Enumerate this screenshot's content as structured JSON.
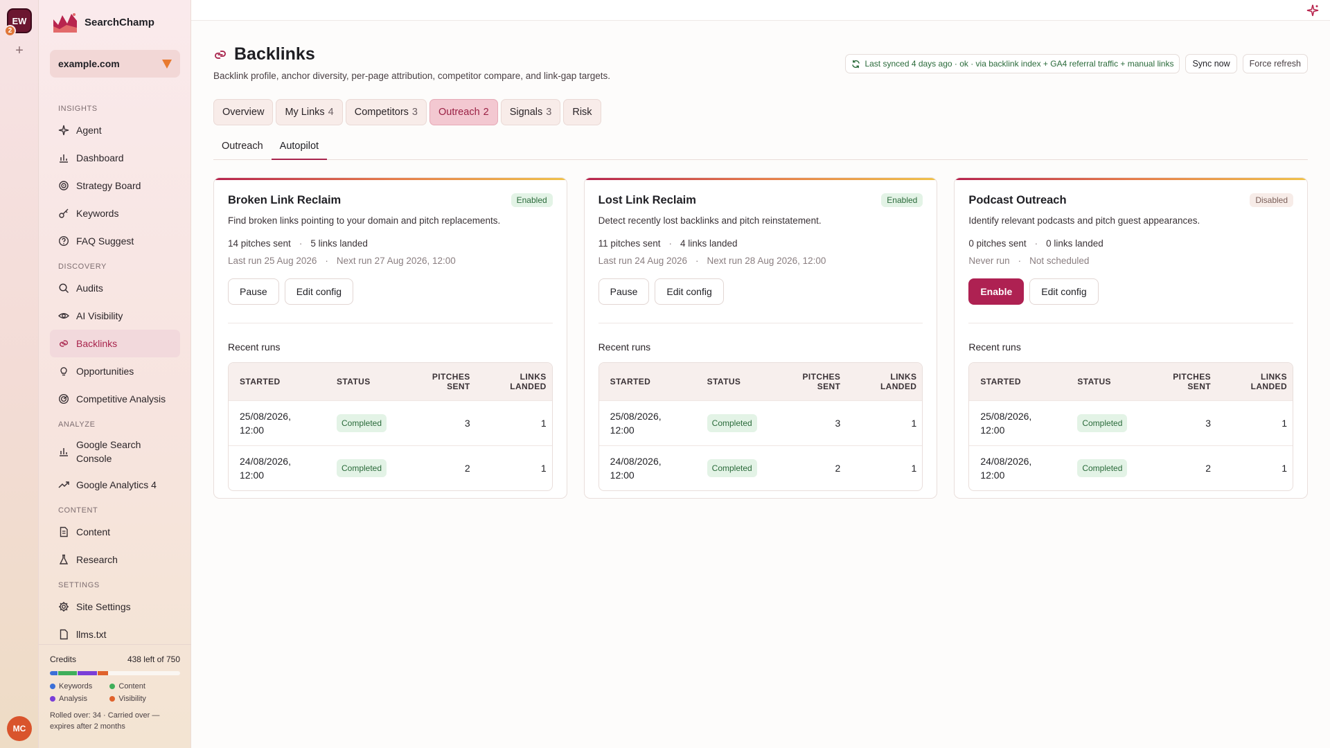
{
  "rail": {
    "workspace_initials": "EW",
    "workspace_badge": "2",
    "add_label": "+",
    "user_initials": "MC"
  },
  "brand": {
    "name": "SearchChamp"
  },
  "domain": {
    "value": "example.com"
  },
  "nav": {
    "sections": [
      {
        "label": "Insights",
        "items": [
          {
            "label": "Agent",
            "icon": "sparkle-icon"
          },
          {
            "label": "Dashboard",
            "icon": "bar-chart-icon"
          },
          {
            "label": "Strategy Board",
            "icon": "target-icon"
          },
          {
            "label": "Keywords",
            "icon": "key-icon"
          },
          {
            "label": "FAQ Suggest",
            "icon": "help-circle-icon"
          }
        ]
      },
      {
        "label": "Discovery",
        "items": [
          {
            "label": "Audits",
            "icon": "search-icon"
          },
          {
            "label": "AI Visibility",
            "icon": "eye-icon"
          },
          {
            "label": "Backlinks",
            "icon": "link-icon",
            "active": true
          },
          {
            "label": "Opportunities",
            "icon": "lightbulb-icon"
          },
          {
            "label": "Competitive Analysis",
            "icon": "radar-icon"
          }
        ]
      },
      {
        "label": "Analyze",
        "items": [
          {
            "label": "Google Search Console",
            "icon": "bar-chart-icon",
            "two_line": true
          },
          {
            "label": "Google Analytics 4",
            "icon": "trend-icon"
          }
        ]
      },
      {
        "label": "Content",
        "items": [
          {
            "label": "Content",
            "icon": "document-icon"
          },
          {
            "label": "Research",
            "icon": "flask-icon"
          }
        ]
      },
      {
        "label": "Settings",
        "items": [
          {
            "label": "Site Settings",
            "icon": "gear-icon"
          },
          {
            "label": "llms.txt",
            "icon": "file-icon"
          }
        ]
      }
    ]
  },
  "credits": {
    "label": "Credits",
    "remaining_text": "438 left of 750",
    "used_fraction": 0.416,
    "segments": [
      {
        "name": "Keywords",
        "fraction": 0.06,
        "color": "#3b6fd8"
      },
      {
        "name": "Content",
        "fraction": 0.14,
        "color": "#3fae5a"
      },
      {
        "name": "Analysis",
        "fraction": 0.15,
        "color": "#7a3ed8"
      },
      {
        "name": "Visibility",
        "fraction": 0.08,
        "color": "#e0622c"
      }
    ],
    "note": "Rolled over: 34 · Carried over — expires after 2 months"
  },
  "page": {
    "title": "Backlinks",
    "subtitle": "Backlink profile, anchor diversity, per-page attribution, competitor compare, and link-gap targets."
  },
  "sync": {
    "status": "Last synced 4 days ago · ok · via backlink index + GA4 referral traffic + manual links",
    "sync_now": "Sync now",
    "force_refresh": "Force refresh"
  },
  "tabs": [
    {
      "label": "Overview",
      "count": ""
    },
    {
      "label": "My Links",
      "count": "4"
    },
    {
      "label": "Competitors",
      "count": "3"
    },
    {
      "label": "Outreach",
      "count": "2",
      "active": true
    },
    {
      "label": "Signals",
      "count": "3"
    },
    {
      "label": "Risk",
      "count": ""
    }
  ],
  "subtabs": [
    {
      "label": "Outreach"
    },
    {
      "label": "Autopilot",
      "active": true
    }
  ],
  "table_headers": {
    "started": "Started",
    "status": "Status",
    "pitches": "Pitches sent",
    "links": "Links landed"
  },
  "recent_runs_label": "Recent runs",
  "cards": [
    {
      "title": "Broken Link Reclaim",
      "status": "Enabled",
      "enabled": true,
      "description": "Find broken links pointing to your domain and pitch replacements.",
      "pitches": "14 pitches sent",
      "links": "5 links landed",
      "last_run": "Last run 25 Aug 2026",
      "next_run": "Next run 27 Aug 2026, 12:00",
      "primary_action": "Pause",
      "secondary_action": "Edit config",
      "runs": [
        {
          "started": "25/08/2026, 12:00",
          "status": "Completed",
          "pitches": "3",
          "links": "1"
        },
        {
          "started": "24/08/2026, 12:00",
          "status": "Completed",
          "pitches": "2",
          "links": "1"
        }
      ]
    },
    {
      "title": "Lost Link Reclaim",
      "status": "Enabled",
      "enabled": true,
      "description": "Detect recently lost backlinks and pitch reinstatement.",
      "pitches": "11 pitches sent",
      "links": "4 links landed",
      "last_run": "Last run 24 Aug 2026",
      "next_run": "Next run 28 Aug 2026, 12:00",
      "primary_action": "Pause",
      "secondary_action": "Edit config",
      "runs": [
        {
          "started": "25/08/2026, 12:00",
          "status": "Completed",
          "pitches": "3",
          "links": "1"
        },
        {
          "started": "24/08/2026, 12:00",
          "status": "Completed",
          "pitches": "2",
          "links": "1"
        }
      ]
    },
    {
      "title": "Podcast Outreach",
      "status": "Disabled",
      "enabled": false,
      "description": "Identify relevant podcasts and pitch guest appearances.",
      "pitches": "0 pitches sent",
      "links": "0 links landed",
      "last_run": "Never run",
      "next_run": "Not scheduled",
      "primary_action": "Enable",
      "secondary_action": "Edit config",
      "runs": [
        {
          "started": "25/08/2026, 12:00",
          "status": "Completed",
          "pitches": "3",
          "links": "1"
        },
        {
          "started": "24/08/2026, 12:00",
          "status": "Completed",
          "pitches": "2",
          "links": "1"
        }
      ]
    }
  ]
}
